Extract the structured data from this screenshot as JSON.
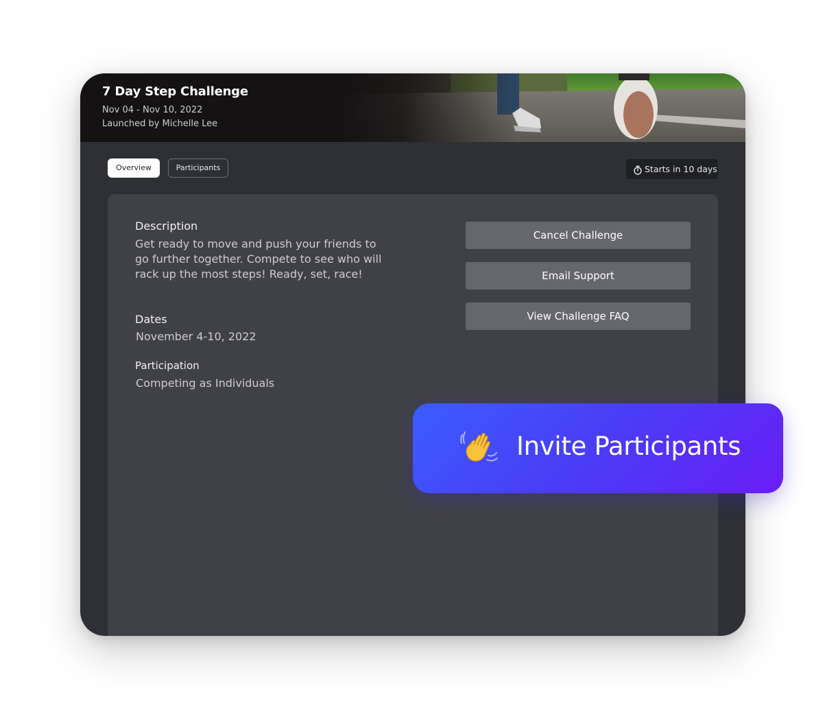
{
  "challenge": {
    "title": "7 Day Step Challenge",
    "date_range": "Nov 04 - Nov 10, 2022",
    "launched_by": "Launched by Michelle Lee"
  },
  "tabs": [
    {
      "label": "Overview",
      "active": true
    },
    {
      "label": "Participants",
      "active": false
    }
  ],
  "status": {
    "icon": "stopwatch-icon",
    "text": "Starts in 10 days"
  },
  "details": {
    "description_label": "Description",
    "description_text": "Get ready to move and push your friends to go further together. Compete to see who will rack up the most steps! Ready, set, race!",
    "dates_label": "Dates",
    "dates_value": "November 4-10, 2022",
    "participation_label": "Participation",
    "participation_value": "Competing as Individuals"
  },
  "actions": {
    "cancel": "Cancel Challenge",
    "email": "Email Support",
    "faq": "View Challenge FAQ"
  },
  "invite": {
    "icon": "waving-hand-icon",
    "label": "Invite Participants"
  },
  "colors": {
    "card_bg": "#2e3036",
    "panel_bg": "#404146",
    "button_bg": "#66676c",
    "invite_gradient_start": "#3b5cff",
    "invite_gradient_end": "#6a1df7"
  }
}
